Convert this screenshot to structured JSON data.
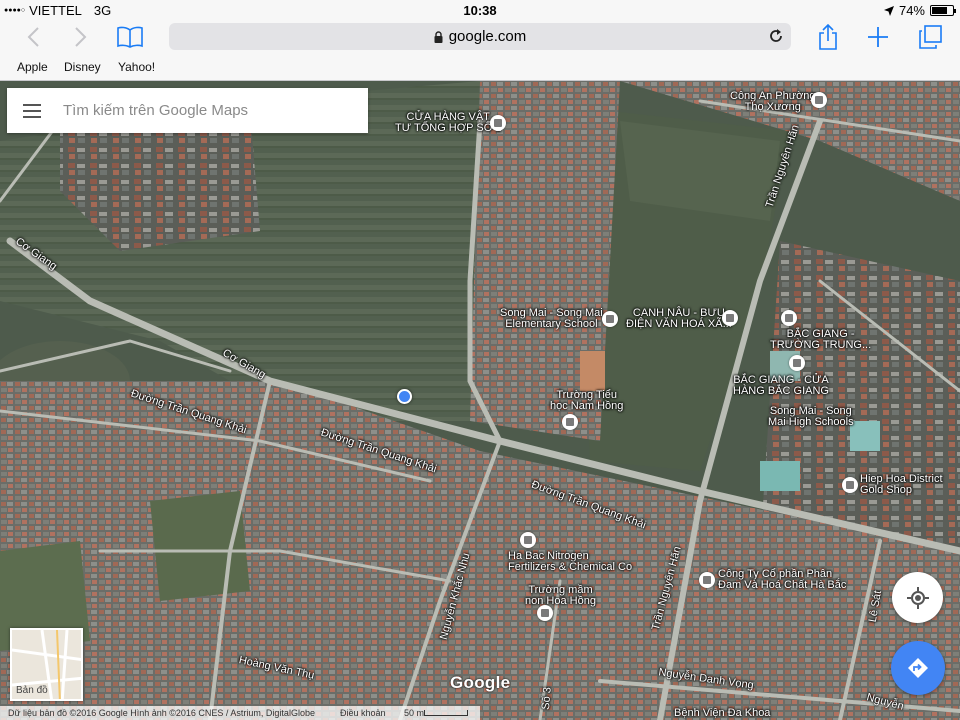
{
  "status_bar": {
    "carrier": "VIETTEL",
    "network": "3G",
    "time": "10:38",
    "battery": "74%",
    "battery_level": 0.74
  },
  "browser": {
    "url": "google.com",
    "icons": [
      "back-icon",
      "forward-icon",
      "bookmarks-icon",
      "lock-icon",
      "reload-icon",
      "share-icon",
      "new-tab-icon",
      "tabs-icon"
    ],
    "favorites": [
      "Apple",
      "Disney",
      "Yahoo!"
    ]
  },
  "map": {
    "search_placeholder": "Tìm kiếm trên Google Maps",
    "minimap_label": "Bản đồ",
    "logo": "Google",
    "attribution": "Dữ liệu bản đồ ©2016 Google Hình ảnh ©2016 CNES / Astrium, DigitalGlobe",
    "terms": "Điều khoản",
    "scale": "50 m",
    "labels": {
      "co_giang_1": "Cơ Giang",
      "co_giang_2": "Cơ Giang",
      "tran_quang_khai_1": "Đường Trần Quang Khải",
      "tran_quang_khai_2": "Đường Trần Quang Khải",
      "tran_quang_khai_3": "Đường Trần Quang Khải",
      "tran_nguyen_han_1": "Trần Nguyên Hãn",
      "tran_nguyen_han_2": "Trần Nguyên Hãn",
      "nguyen_khac_nhu": "Nguyễn Khắc Nhu",
      "hoang_van_thu": "Hoàng Văn Thụ",
      "le_sat": "Lê Sát",
      "nguyen_danh_vong": "Nguyễn Danh Vọng",
      "nguyen_2": "Nguyễn",
      "so_3": "Số 3"
    },
    "pois": {
      "cua_hang_vat_tu_1": "CỬA HÀNG VẬT",
      "cua_hang_vat_tu_2": "TƯ TỔNG HỢP SỐ 1",
      "cong_an_1": "Công An Phường",
      "cong_an_2": "Thọ Xương",
      "song_mai_elem_1": "Song Mai - Song Mai",
      "song_mai_elem_2": "Elementary School",
      "canh_nau_1": "CANH NÂU - BƯU",
      "canh_nau_2": "ĐIỆN VĂN HOÁ XÃ...",
      "bac_giang_truong_1": "BẮC GIANG -",
      "bac_giang_truong_2": "TRƯỜNG TRUNG...",
      "bac_giang_cua_hang_1": "BẮC GIANG - CỬA",
      "bac_giang_cua_hang_2": "HÀNG BẮC GIANG",
      "song_mai_high_1": "Song Mai - Song",
      "song_mai_high_2": "Mai High Schools",
      "nam_hong_1": "Trường Tiểu",
      "nam_hong_2": "học Nam Hồng",
      "hiep_hoa_1": "Hiep Hoa District",
      "hiep_hoa_2": "Gold Shop",
      "ha_bac_1": "Ha Bac Nitrogen",
      "ha_bac_2": "Fertilizers & Chemical Co",
      "mam_non_1": "Trường mầm",
      "mam_non_2": "non Hoa Hồng",
      "cong_ty_1": "Công Ty Cổ phần Phân",
      "cong_ty_2": "Đạm Và Hoá Chất Hà Bắc",
      "benh_vien": "Bệnh Viện Đa Khoa"
    }
  }
}
